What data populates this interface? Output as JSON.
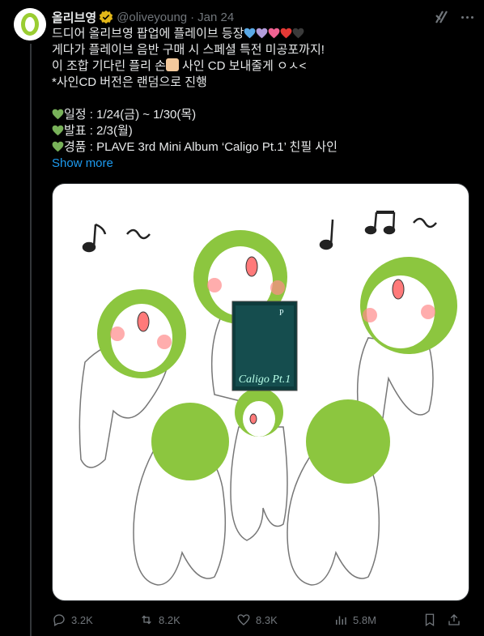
{
  "account": {
    "name": "올리브영",
    "handle": "@oliveyoung",
    "separator": "·",
    "date": "Jan 24"
  },
  "tweet": {
    "line1": "드디어 올리브영 팝업에 플레이브 등장",
    "line2": "게다가 플레이브 음반 구매 시 스페셜 특전 미공포까지!",
    "line3a": "이 조합 기다린 플리 손",
    "line3b": " 사인 CD 보내줄게 ㅇㅅ<",
    "line4": "*사인CD 버전은 랜덤으로 진행",
    "line6": "일정 : 1/24(금) ~ 1/30(목)",
    "line7": "발표 : 2/3(월)",
    "line8": "경품 : PLAVE 3rd Mini Album ‘Caligo Pt.1’ 친필 사인",
    "show_more": "Show more",
    "heart_colors": [
      "#5aa9e6",
      "#b39ddb",
      "#f06292",
      "#e53935",
      "#3a3a3a"
    ],
    "green_heart": "#78b159"
  },
  "media": {
    "album_title": "Caligo Pt.1",
    "album_logo": "P"
  },
  "actions": {
    "replies": "3.2K",
    "reposts": "8.2K",
    "likes": "8.3K",
    "views": "5.8M"
  },
  "icons": {
    "reply": "reply-icon",
    "repost": "repost-icon",
    "like": "like-icon",
    "views": "views-icon",
    "bookmark": "bookmark-icon",
    "share": "share-icon"
  }
}
